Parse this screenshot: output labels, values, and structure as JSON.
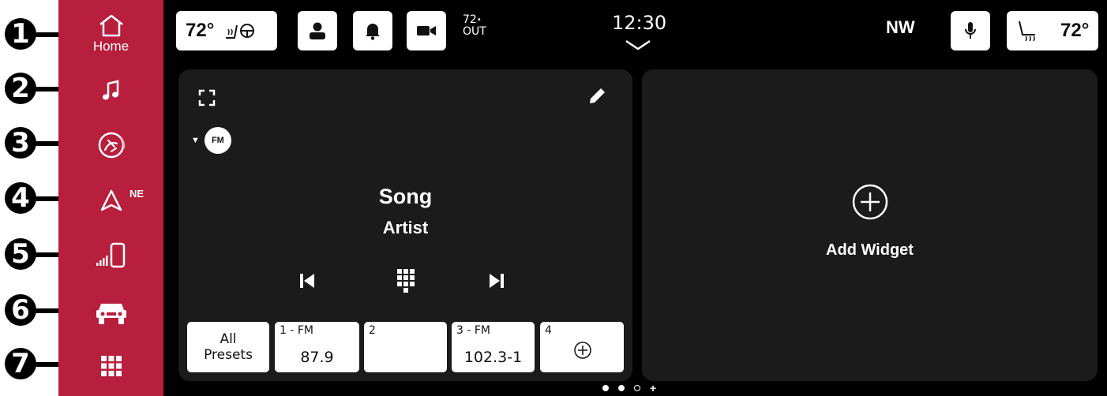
{
  "callouts": [
    "1",
    "2",
    "3",
    "4",
    "5",
    "6",
    "7"
  ],
  "sidebar": {
    "home_label": "Home",
    "nav_direction": "NE",
    "items": [
      "home-icon",
      "music-note-icon",
      "climate-fan-icon",
      "navigation-arrow-icon",
      "phone-signal-icon",
      "vehicle-icon",
      "apps-grid-icon"
    ]
  },
  "status_bar": {
    "left_temp": "72°",
    "outside_temp": "72",
    "outside_label": "OUT",
    "time": "12:30",
    "compass": "NW",
    "right_temp": "72°"
  },
  "media_widget": {
    "band": "FM",
    "song": "Song",
    "artist": "Artist",
    "presets": [
      {
        "label": "1 - FM",
        "freq": "87.9"
      },
      {
        "label": "2",
        "freq": ""
      },
      {
        "label": "3 - FM",
        "freq": "102.3-1"
      },
      {
        "label": "4",
        "freq": ""
      }
    ],
    "all_presets_line1": "All",
    "all_presets_line2": "Presets"
  },
  "add_widget": {
    "label": "Add Widget"
  },
  "page_indicator": {
    "plus": "+"
  },
  "colors": {
    "sidebar": "#b71f3d",
    "screen": "#000000",
    "panel": "#1b1b1b"
  }
}
